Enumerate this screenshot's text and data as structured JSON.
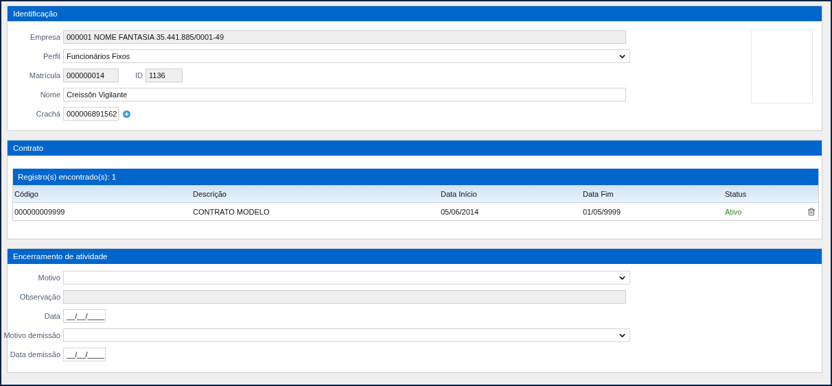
{
  "identification": {
    "title": "Identificação",
    "rows": [
      {
        "kind": "wide",
        "label": "Empresa",
        "value": "000001 NOME FANTASIA 35.441.885/0001-49",
        "disabled": true
      },
      {
        "kind": "select",
        "label": "Perfil",
        "value": "Funcionários Fixos",
        "disabled": false
      },
      {
        "kind": "short",
        "label": "Matrícula",
        "value": "000000014",
        "disabled": true,
        "extra": {
          "label": "ID",
          "value": "1136",
          "disabled": true
        }
      },
      {
        "kind": "wide",
        "label": "Nome",
        "value": "Creissôn Vigilante",
        "disabled": false
      },
      {
        "kind": "short-add",
        "label": "Crachá",
        "value": "000006891562",
        "disabled": false
      }
    ]
  },
  "contract": {
    "title": "Contrato",
    "records": "Registro(s) encontrado(s): 1",
    "columns": [
      "Código",
      "Descrição",
      "Data Início",
      "Data Fim",
      "Status"
    ],
    "rows": [
      {
        "cells": [
          "000000009999",
          "CONTRATO MODELO",
          "05/06/2014",
          "01/05/9999",
          "Ativo"
        ],
        "color": "#2e8b2e"
      }
    ]
  },
  "termination": {
    "title": "Encerramento de atividade",
    "rows": [
      {
        "kind": "select",
        "label": "Motivo",
        "value": "",
        "disabled": false
      },
      {
        "kind": "wide",
        "label": "Observação",
        "value": "",
        "disabled": true
      },
      {
        "kind": "date",
        "label": "Data",
        "value": "__/__/____",
        "disabled": false
      },
      {
        "kind": "select",
        "label": "Motivo demissão",
        "value": "",
        "disabled": false
      },
      {
        "kind": "date",
        "label": "Data demissão",
        "value": "__/__/____",
        "disabled": false
      }
    ]
  }
}
